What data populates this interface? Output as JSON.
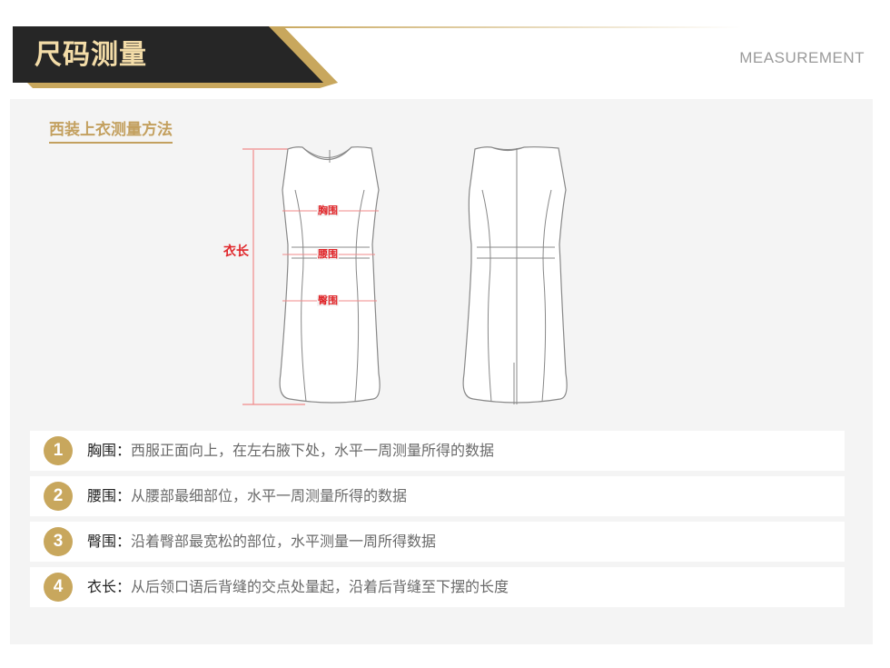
{
  "header": {
    "title": "尺码测量",
    "subtitle": "MEASUREMENT"
  },
  "section": {
    "title": "西装上衣测量方法"
  },
  "diagram": {
    "length_label": "衣长",
    "chest_label": "胸围",
    "waist_label": "腰围",
    "hip_label": "臀围"
  },
  "measurements": [
    {
      "num": "1",
      "term": "胸围",
      "desc": "西服正面向上，在左右腋下处，水平一周测量所得的数据"
    },
    {
      "num": "2",
      "term": "腰围",
      "desc": "从腰部最细部位，水平一周测量所得的数据"
    },
    {
      "num": "3",
      "term": "臀围",
      "desc": "沿着臀部最宽松的部位，水平测量一周所得数据"
    },
    {
      "num": "4",
      "term": "衣长",
      "desc": "从后领口语后背缝的交点处量起，沿着后背缝至下摆的长度"
    }
  ],
  "colors": {
    "header_dark": "#262626",
    "gold": "#c8a75d",
    "measure_red": "#e0262a",
    "panel_bg": "#f4f4f4"
  }
}
